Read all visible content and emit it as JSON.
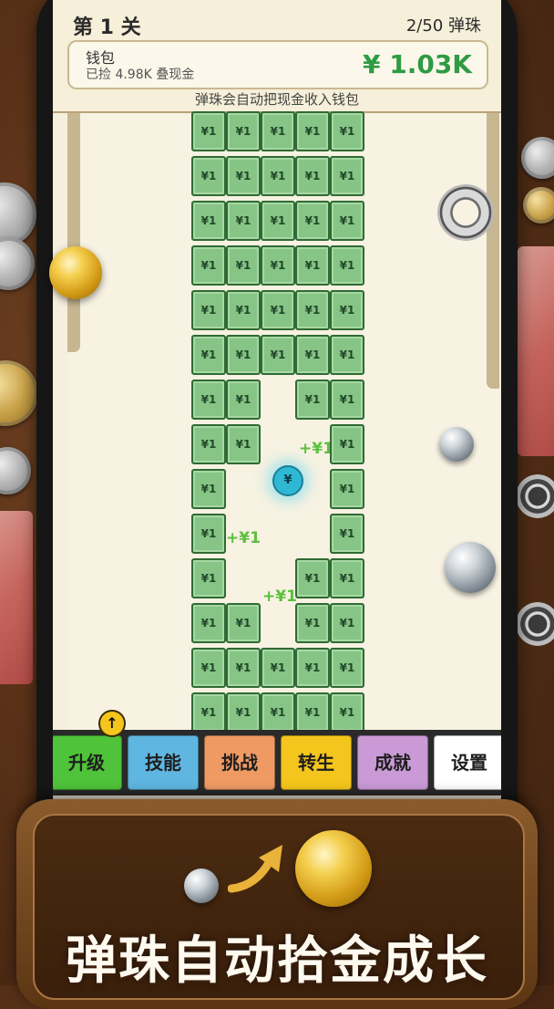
{
  "header": {
    "level_label": "第 1 关",
    "ball_count": "2/50 弹珠"
  },
  "wallet": {
    "title": "钱包",
    "collected": "已捡 4.98K 叠现金",
    "amount": "¥ 1.03K"
  },
  "hint": "弹珠会自动把现金收入钱包",
  "brick_label": "¥1",
  "popups": [
    "+¥1",
    "+¥1",
    "+¥1"
  ],
  "coin_ball_label": "¥",
  "upgrade_badge": "↑",
  "buttons": [
    {
      "label": "升级",
      "color": "#4fc33a"
    },
    {
      "label": "技能",
      "color": "#5fb6e0"
    },
    {
      "label": "挑战",
      "color": "#ef9a63"
    },
    {
      "label": "转生",
      "color": "#f4c51c"
    },
    {
      "label": "成就",
      "color": "#c99ad6"
    },
    {
      "label": "设置",
      "color": "#ffffff"
    }
  ],
  "tagline": "弹珠自动拾金成长"
}
